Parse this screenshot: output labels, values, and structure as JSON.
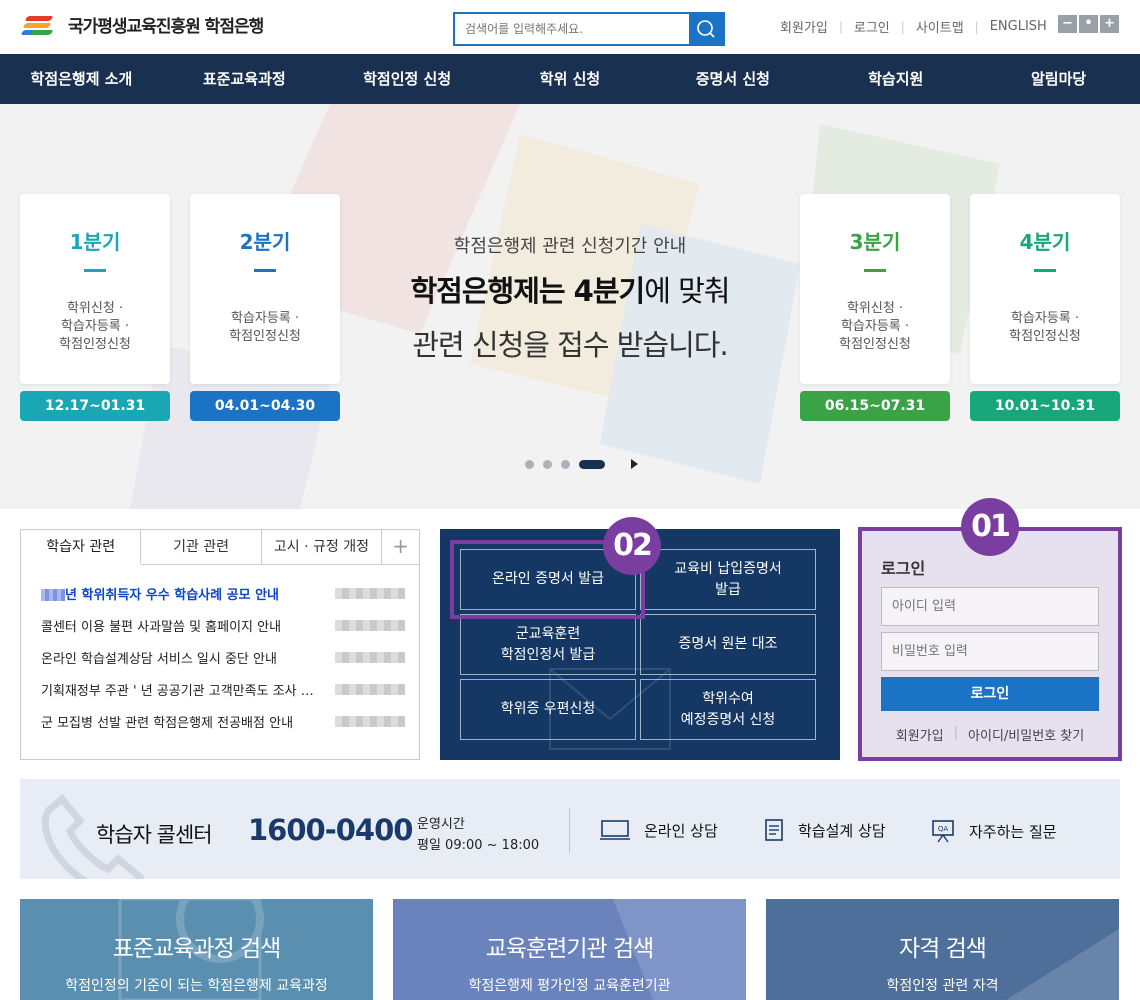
{
  "header": {
    "logo_text": "국가평생교육진흥원  학점은행",
    "search_placeholder": "검색어를 입력해주세요.",
    "util_links": [
      "회원가입",
      "로그인",
      "사이트맵",
      "ENGLISH"
    ],
    "zoom_controls": [
      "−",
      "•",
      "+"
    ]
  },
  "nav": {
    "items": [
      "학점은행제 소개",
      "표준교육과정",
      "학점인정 신청",
      "학위 신청",
      "증명서 신청",
      "학습지원",
      "알림마당"
    ]
  },
  "banner": {
    "line1": "학점은행제 관련 신청기간 안내",
    "line2_bold": "학점은행제는 4분기",
    "line2_rest": "에 맞춰",
    "line3": "관련 신청을 접수 받습니다.",
    "quarters": [
      {
        "title": "1분기",
        "lines": [
          "학위신청 ·",
          "학습자등록 ·",
          "학점인정신청"
        ],
        "period": "12.17~01.31",
        "color": "#1aa7b5",
        "date_bg": "#1aa7b5"
      },
      {
        "title": "2분기",
        "lines": [
          "학습자등록 ·",
          "학점인정신청"
        ],
        "period": "04.01~04.30",
        "color": "#1a73c5",
        "date_bg": "#1a73c5"
      },
      {
        "title": "3분기",
        "lines": [
          "학위신청 ·",
          "학습자등록 ·",
          "학점인정신청"
        ],
        "period": "06.15~07.31",
        "color": "#3aa346",
        "date_bg": "#3aa346"
      },
      {
        "title": "4분기",
        "lines": [
          "학습자등록 ·",
          "학점인정신청"
        ],
        "period": "10.01~10.31",
        "color": "#16a77a",
        "date_bg": "#16a77a"
      }
    ]
  },
  "notice": {
    "tabs": [
      "학습자 관련",
      "기관 관련",
      "고시 · 규정 개정"
    ],
    "more": "+",
    "items": [
      "년 학위취득자 우수 학습사례 공모 안내",
      "콜센터 이용 불편 사과말씀 및 홈페이지 안내",
      "온라인 학습설계상담 서비스 일시 중단 안내",
      "기획재정부 주관 '      년 공공기관 고객만족도 조사 안내",
      "군 모집병 선발 관련 학점은행제 전공배점 안내"
    ]
  },
  "cert": {
    "buttons": [
      "온라인 증명서 발급",
      "교육비 납입증명서\n발급",
      "군교육훈련\n학점인정서 발급",
      "증명서 원본 대조",
      "학위증 우편신청",
      "학위수여\n예정증명서 신청"
    ]
  },
  "login": {
    "title": "로그인",
    "id_placeholder": "아이디 입력",
    "pw_placeholder": "비밀번호 입력",
    "button": "로그인",
    "links": [
      "회원가입",
      "아이디/비밀번호 찾기"
    ]
  },
  "badges": {
    "b1": "01",
    "b2": "02",
    "color": "#7a3ea1"
  },
  "callcenter": {
    "title": "학습자 콜센터",
    "number": "1600-0400",
    "hours_label": "운영시간",
    "hours": "평일 09:00 ~ 18:00",
    "links": [
      {
        "label": "온라인 상담",
        "icon": "monitor-icon"
      },
      {
        "label": "학습설계 상담",
        "icon": "document-icon"
      },
      {
        "label": "자주하는 질문",
        "icon": "faq-board-icon"
      }
    ]
  },
  "cards": [
    {
      "title": "표준교육과정 검색",
      "subtitle": "학점인정의 기준이 되는 학점은행제 교육과정",
      "bg": "#5a8fb0"
    },
    {
      "title": "교육훈련기관 검색",
      "subtitle": "학점은행제 평가인정 교육훈련기관",
      "bg": "#6a83bd"
    },
    {
      "title": "자격 검색",
      "subtitle": "학점인정 관련 자격",
      "bg": "#4d6f99"
    }
  ],
  "colors": {
    "navy": "#1a3050",
    "blue": "#1a73c5",
    "purple": "#7a3ea1"
  }
}
